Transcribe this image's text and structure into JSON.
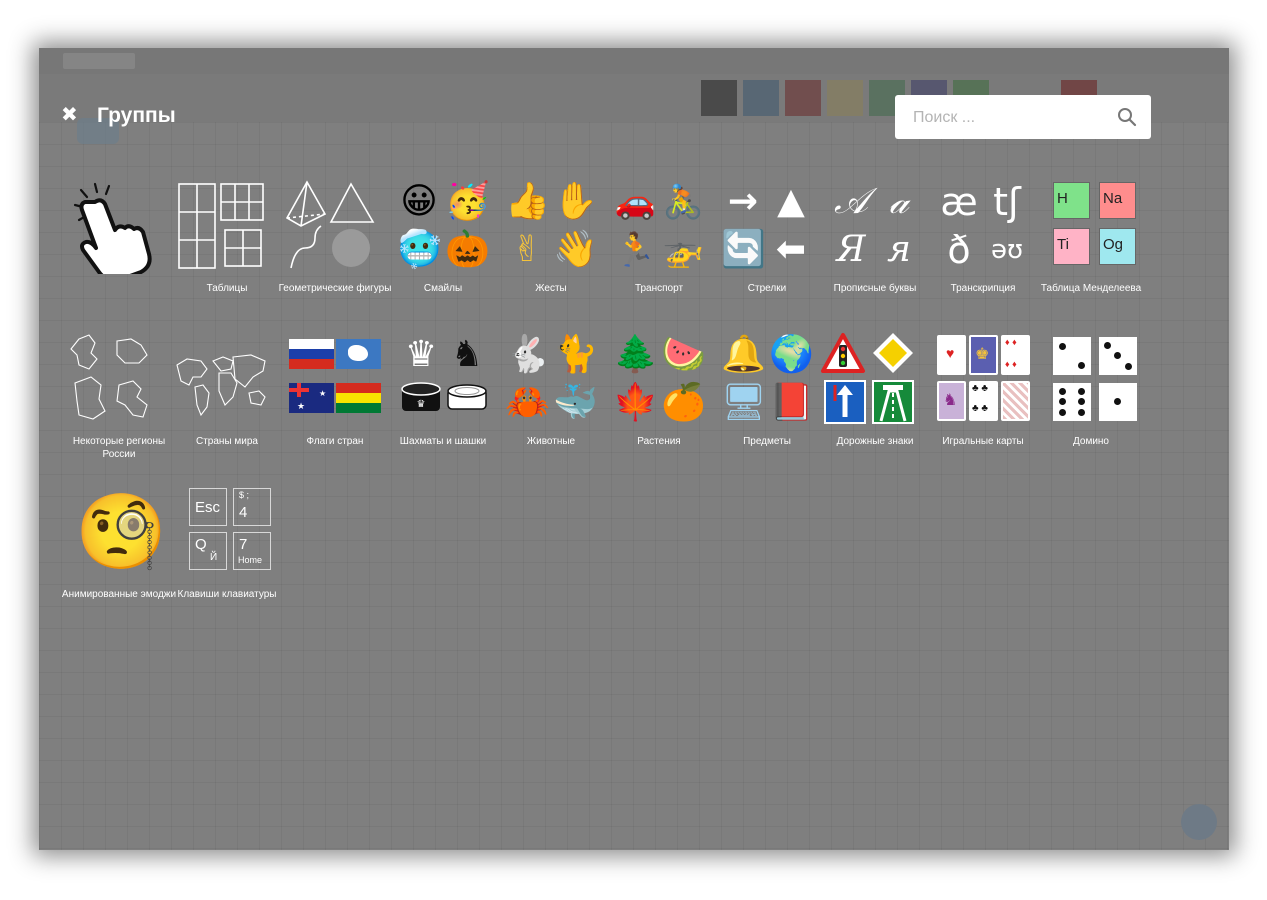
{
  "header": {
    "title": "Группы",
    "close_symbol": "✖",
    "search_placeholder": "Поиск ..."
  },
  "groups": [
    {
      "label": "",
      "icon": "pointing-hand-icon"
    },
    {
      "label": "Таблицы",
      "icon": "table-grids-icon"
    },
    {
      "label": "Геометрические фигуры",
      "icon": "geometric-shapes-icon"
    },
    {
      "label": "Смайлы",
      "icon": "smiley-emojis-icon",
      "glyphs": [
        "😀",
        "🥳",
        "🥶",
        "🎃"
      ]
    },
    {
      "label": "Жесты",
      "icon": "gesture-emojis-icon",
      "glyphs": [
        "👍",
        "✋",
        "✌",
        "👋"
      ]
    },
    {
      "label": "Транспорт",
      "icon": "transport-emojis-icon",
      "glyphs": [
        "🚗",
        "🚴",
        "🏃",
        "🚁"
      ]
    },
    {
      "label": "Стрелки",
      "icon": "arrows-icon",
      "glyphs": [
        "→",
        "▲",
        "🔄",
        "⬅"
      ]
    },
    {
      "label": "Прописные буквы",
      "icon": "cursive-letters-icon",
      "glyphs": [
        "𝒜",
        "𝒶",
        "Я",
        "я"
      ]
    },
    {
      "label": "Транскрипция",
      "icon": "phonetic-transcription-icon",
      "glyphs": [
        "æ",
        "tʃ",
        "ð",
        "əʊ"
      ]
    },
    {
      "label": "Таблица Менделеева",
      "icon": "periodic-table-icon",
      "glyphs": [
        "H",
        "Na",
        "Ti",
        "Og"
      ]
    },
    {
      "label": "Некоторые регионы России",
      "icon": "russia-regions-icon"
    },
    {
      "label": "Страны мира",
      "icon": "world-map-icon"
    },
    {
      "label": "Флаги стран",
      "icon": "country-flags-icon"
    },
    {
      "label": "Шахматы и шашки",
      "icon": "chess-checkers-icon",
      "glyphs": [
        "♛",
        "♞"
      ]
    },
    {
      "label": "Животные",
      "icon": "animal-emojis-icon",
      "glyphs": [
        "🐇",
        "🐈",
        "🦀",
        "🐳"
      ]
    },
    {
      "label": "Растения",
      "icon": "plant-emojis-icon",
      "glyphs": [
        "🌲",
        "🍉",
        "🍁",
        "🍊"
      ]
    },
    {
      "label": "Предметы",
      "icon": "object-emojis-icon",
      "glyphs": [
        "🔔",
        "🌍",
        "🖥",
        "📕"
      ]
    },
    {
      "label": "Дорожные знаки",
      "icon": "road-signs-icon"
    },
    {
      "label": "Игральные карты",
      "icon": "playing-cards-icon"
    },
    {
      "label": "Домино",
      "icon": "domino-icon"
    },
    {
      "label": "Анимированные эмоджи",
      "icon": "animated-emoji-icon",
      "glyphs": [
        "🧐"
      ]
    },
    {
      "label": "Клавиши клавиатуры",
      "icon": "keyboard-keys-icon",
      "keys": [
        {
          "main": "Esc",
          "sub": ""
        },
        {
          "main": "4",
          "sub": "$ ;"
        },
        {
          "main": "Q",
          "sub": "Й"
        },
        {
          "main": "7",
          "sub": "Home"
        }
      ]
    }
  ],
  "colors": {
    "overlay": "#7f7f7f",
    "text": "#ffffff",
    "search_bg": "#ffffff"
  }
}
